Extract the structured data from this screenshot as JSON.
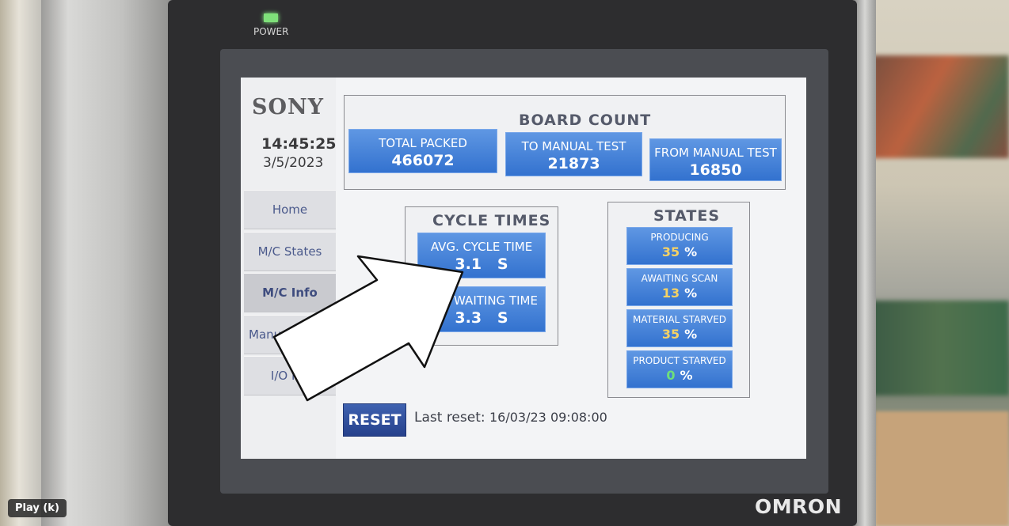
{
  "device": {
    "power_label": "POWER",
    "brand": "OMRON"
  },
  "hmi": {
    "logo": "SONY",
    "time": "14:45:25",
    "date": "3/5/2023",
    "nav": [
      {
        "label": "Home"
      },
      {
        "label": "M/C States"
      },
      {
        "label": "M/C Info",
        "active": true
      },
      {
        "label": "Manual"
      },
      {
        "label": "I/O Mo"
      }
    ],
    "board_count": {
      "title": "BOARD COUNT",
      "tiles": [
        {
          "label": "TOTAL PACKED",
          "value": "466072"
        },
        {
          "label": "TO MANUAL TEST",
          "value": "21873"
        },
        {
          "label": "FROM MANUAL TEST",
          "value": "16850"
        }
      ]
    },
    "cycle_times": {
      "title": "CYCLE TIMES",
      "tiles": [
        {
          "label": "AVG. CYCLE TIME",
          "value": "3.1",
          "unit": "S"
        },
        {
          "label": "WAITING TIME",
          "value": "3.3",
          "unit": "S"
        }
      ]
    },
    "states": {
      "title": "STATES",
      "items": [
        {
          "label": "PRODUCING",
          "value": "35",
          "unit": "%"
        },
        {
          "label": "AWAITING SCAN",
          "value": "13",
          "unit": "%"
        },
        {
          "label": "MATERIAL STARVED",
          "value": "35",
          "unit": "%"
        },
        {
          "label": "PRODUCT STARVED",
          "value": "0",
          "unit": "%"
        }
      ]
    },
    "reset": {
      "button_label": "RESET",
      "last_reset_label": "Last reset:",
      "last_reset_value": "16/03/23  09:08:00"
    }
  },
  "player": {
    "play_label": "Play (k)"
  },
  "colors": {
    "tile_blue": "#3f7fd8",
    "reset_blue": "#2f4d9c",
    "value_yellow": "#f6d264",
    "value_green": "#6ee07a"
  }
}
